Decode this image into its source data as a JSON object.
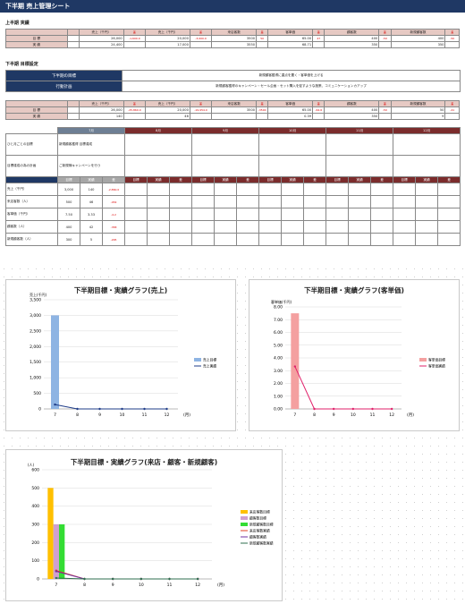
{
  "title": "下半期 売上管理シート",
  "first_half": {
    "section": "上半期 実績",
    "headers": [
      "売上（千円）",
      "差",
      "売上（千円）",
      "差",
      "来店客数",
      "差",
      "客単価",
      "差",
      "顧客数",
      "差",
      "新規顧客数",
      "差"
    ],
    "row_labels": [
      "目 標",
      "実 績"
    ],
    "target": [
      "26,000",
      "-1,600.0",
      "20,000",
      "-3,000.0",
      "3500",
      "50",
      "65.00",
      "47",
      "400",
      "-50",
      "400",
      "-50"
    ],
    "actual": [
      "24,400",
      "",
      "17,000",
      "",
      "3550",
      "",
      "68.71",
      "",
      "350",
      "",
      "350",
      ""
    ]
  },
  "goal_setting": {
    "section": "下半期 目標設定",
    "label_goal": "下半期の目標",
    "goal_text": "新規顧客獲得に重点を置く・客単価を上げる",
    "label_plan": "行動計画",
    "plan_text": "新規顧客獲得のキャンペーン・セール企画・セット購入を促すような施策、コミュニケーションカアップ",
    "row_labels": [
      "目 標",
      "実 績"
    ],
    "target": [
      "26,000",
      "-25,860.0",
      "20,000",
      "-19,954.0",
      "3500",
      "-3500",
      "65.00",
      "-64.6",
      "400",
      "-50",
      "50",
      "-41"
    ],
    "actual": [
      "140",
      "",
      "46",
      "",
      "",
      "",
      "0.39",
      "",
      "350",
      "",
      "9",
      ""
    ]
  },
  "monthly": {
    "months": [
      "7月",
      "8月",
      "9月",
      "10月",
      "11月",
      "12月"
    ],
    "row1_label": "ひと月ごとの目標",
    "row1_text": "新規顧客獲得 目標達成",
    "row2_label": "目標達成の為の計画",
    "row2_text": "ご新規様キャンペーンを行う",
    "col_headers": [
      "目標",
      "実績",
      "差"
    ],
    "metrics": [
      {
        "label": "売上（千円）",
        "target": "3,000",
        "actual": "140",
        "diff": "-2,860.0"
      },
      {
        "label": "来店客数（人）",
        "target": "500",
        "actual": "46",
        "diff": "-454"
      },
      {
        "label": "客単価（千円）",
        "target": "7.50",
        "actual": "3.33",
        "diff": "-4.2"
      },
      {
        "label": "顧客数（人）",
        "target": "400",
        "actual": "42",
        "diff": "-358"
      },
      {
        "label": "新規顧客数（人）",
        "target": "300",
        "actual": "5",
        "diff": "-295"
      }
    ]
  },
  "chart_data": [
    {
      "type": "bar",
      "title": "下半期目標・実績グラフ(売上)",
      "ylabel": "売上(千円)",
      "xlabel": "(月)",
      "categories": [
        "7",
        "8",
        "9",
        "10",
        "11",
        "12"
      ],
      "ylim": [
        0,
        3500
      ],
      "yticks": [
        "0",
        "500",
        "1,000",
        "1,500",
        "2,000",
        "2,500",
        "3,000",
        "3,500"
      ],
      "series": [
        {
          "name": "売上目標",
          "kind": "bar",
          "color": "#8eb4e3",
          "values": [
            3000,
            0,
            0,
            0,
            0,
            0
          ]
        },
        {
          "name": "売上実績",
          "kind": "line",
          "color": "#1f3c88",
          "values": [
            140,
            0,
            0,
            0,
            0,
            0
          ]
        }
      ],
      "legend": "right"
    },
    {
      "type": "bar",
      "title": "下半期目標・実績グラフ(客単価)",
      "ylabel": "客単価(千円)",
      "xlabel": "(月)",
      "categories": [
        "7",
        "8",
        "9",
        "10",
        "11",
        "12"
      ],
      "ylim": [
        0,
        8
      ],
      "yticks": [
        "0.00",
        "1.00",
        "2.00",
        "3.00",
        "4.00",
        "5.00",
        "6.00",
        "7.00",
        "8.00"
      ],
      "series": [
        {
          "name": "客単価目標",
          "kind": "bar",
          "color": "#f4a0a0",
          "values": [
            7.5,
            0,
            0,
            0,
            0,
            0
          ]
        },
        {
          "name": "客単価実績",
          "kind": "line",
          "color": "#e0206a",
          "values": [
            3.33,
            0,
            0,
            0,
            0,
            0
          ]
        }
      ],
      "legend": "right"
    },
    {
      "type": "bar",
      "title": "下半期目標・実績グラフ(来店・顧客・新規顧客)",
      "ylabel": "(人)",
      "xlabel": "(月)",
      "categories": [
        "7",
        "8",
        "9",
        "10",
        "11",
        "12"
      ],
      "ylim": [
        0,
        600
      ],
      "yticks": [
        "0",
        "100",
        "200",
        "300",
        "400",
        "500",
        "600"
      ],
      "series": [
        {
          "name": "来店客数目標",
          "kind": "bar",
          "color": "#ffc000",
          "values": [
            500,
            0,
            0,
            0,
            0,
            0
          ]
        },
        {
          "name": "顧客数目標",
          "kind": "bar",
          "color": "#d0a0d0",
          "values": [
            300,
            0,
            0,
            0,
            0,
            0
          ]
        },
        {
          "name": "新規顧客数目標",
          "kind": "bar",
          "color": "#33dd33",
          "values": [
            300,
            0,
            0,
            0,
            0,
            0
          ]
        },
        {
          "name": "来店客数実績",
          "kind": "line",
          "color": "#e04020",
          "values": [
            46,
            0,
            0,
            0,
            0,
            0
          ]
        },
        {
          "name": "顧客数実績",
          "kind": "line",
          "color": "#7030a0",
          "values": [
            42,
            0,
            0,
            0,
            0,
            0
          ]
        },
        {
          "name": "新規顧客数実績",
          "kind": "line",
          "color": "#2f6f4f",
          "values": [
            5,
            0,
            0,
            0,
            0,
            0
          ]
        }
      ],
      "legend": "right"
    }
  ]
}
